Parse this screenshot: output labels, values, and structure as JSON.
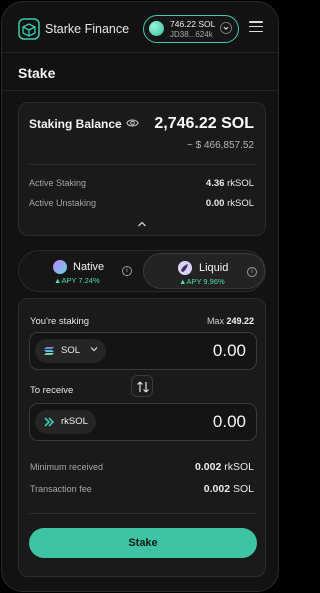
{
  "header": {
    "brand": "Starke Finance",
    "wallet_balance": "746.22 SOL",
    "wallet_address": "JD38...624k"
  },
  "page_title": "Stake",
  "balance": {
    "label": "Staking Balance",
    "value": "2,746.22 SOL",
    "usd": "~ $ 466,857.52",
    "rows": [
      {
        "label": "Active Staking",
        "amount": "4.36",
        "unit": "rkSOL"
      },
      {
        "label": "Active Unstaking",
        "amount": "0.00",
        "unit": "rkSOL"
      }
    ]
  },
  "toggle": {
    "native": {
      "name": "Native",
      "apy": "APY 7.24%"
    },
    "liquid": {
      "name": "Liquid",
      "apy": "APY 9.96%"
    },
    "selected": "liquid"
  },
  "form": {
    "staking_label": "You're staking",
    "max_label": "Max",
    "max_value": "249.22",
    "from_token": "SOL",
    "from_amount": "0.00",
    "receive_label": "To receive",
    "to_token": "rkSOL",
    "to_amount": "0.00",
    "details": [
      {
        "label": "Minimum received",
        "amount": "0.002",
        "unit": "rkSOL"
      },
      {
        "label": "Transaction fee",
        "amount": "0.002",
        "unit": "SOL"
      }
    ],
    "submit_label": "Stake"
  },
  "colors": {
    "accent": "#3ec4a4",
    "apy_green": "#4fdab1",
    "background": "#121212",
    "card": "#1a1a1a"
  },
  "icons": [
    "logo-icon",
    "wallet-avatar-icon",
    "chevron-down-icon",
    "menu-icon",
    "eye-icon",
    "chevron-up-icon",
    "info-icon",
    "solana-icon",
    "rksol-icon",
    "swap-arrows-icon"
  ]
}
